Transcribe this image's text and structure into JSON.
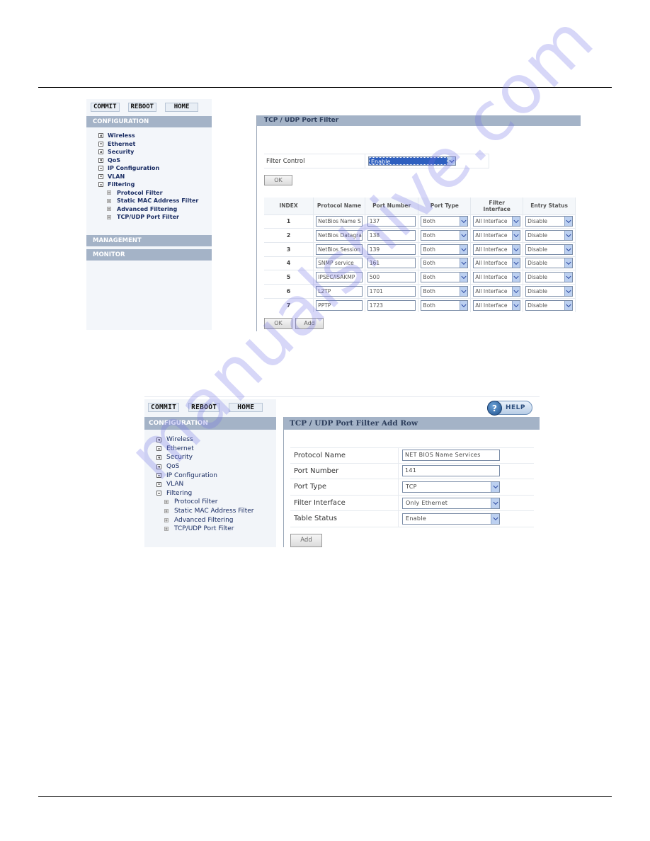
{
  "screen1": {
    "top_buttons": [
      "COMMIT",
      "REBOOT",
      "HOME"
    ],
    "sections": {
      "configuration": "CONFIGURATION",
      "management": "MANAGEMENT",
      "monitor": "MONITOR"
    },
    "tree": [
      {
        "label": "Wireless",
        "icon": "plus"
      },
      {
        "label": "Ethernet",
        "icon": "minus"
      },
      {
        "label": "Security",
        "icon": "plus"
      },
      {
        "label": "QoS",
        "icon": "plus"
      },
      {
        "label": "IP Configuration",
        "icon": "minus"
      },
      {
        "label": "VLAN",
        "icon": "minus"
      },
      {
        "label": "Filtering",
        "icon": "minus"
      }
    ],
    "subtree": [
      "Protocol Filter",
      "Static MAC Address Filter",
      "Advanced Filtering",
      "TCP/UDP Port Filter"
    ],
    "panel": {
      "title": "TCP / UDP Port Filter",
      "filter_control_label": "Filter Control",
      "filter_control_value": "Enable",
      "ok_label": "OK",
      "add_label": "Add",
      "columns": [
        "INDEX",
        "Protocol Name",
        "Port Number",
        "Port Type",
        "Filter Interface",
        "Entry Status"
      ],
      "rows": [
        {
          "index": "1",
          "protocol": "NetBios Name S",
          "port": "137",
          "type": "Both",
          "iface": "All Interface",
          "status": "Disable"
        },
        {
          "index": "2",
          "protocol": "NetBios Datagra",
          "port": "138",
          "type": "Both",
          "iface": "All Interface",
          "status": "Disable"
        },
        {
          "index": "3",
          "protocol": "NetBios Session",
          "port": "139",
          "type": "Both",
          "iface": "All Interface",
          "status": "Disable"
        },
        {
          "index": "4",
          "protocol": "SNMP service",
          "port": "161",
          "type": "Both",
          "iface": "All Interface",
          "status": "Disable"
        },
        {
          "index": "5",
          "protocol": "IPSEC/ISAKMP",
          "port": "500",
          "type": "Both",
          "iface": "All Interface",
          "status": "Disable"
        },
        {
          "index": "6",
          "protocol": "L2TP",
          "port": "1701",
          "type": "Both",
          "iface": "All Interface",
          "status": "Disable"
        },
        {
          "index": "7",
          "protocol": "PPTP",
          "port": "1723",
          "type": "Both",
          "iface": "All Interface",
          "status": "Disable"
        }
      ]
    }
  },
  "screen2": {
    "top_buttons": [
      "COMMIT",
      "REBOOT",
      "HOME"
    ],
    "help_label": "HELP",
    "help_icon": "?",
    "sections": {
      "configuration": "CONFIGURATION"
    },
    "tree": [
      {
        "label": "Wireless",
        "icon": "plus"
      },
      {
        "label": "Ethernet",
        "icon": "minus"
      },
      {
        "label": "Security",
        "icon": "plus"
      },
      {
        "label": "QoS",
        "icon": "plus"
      },
      {
        "label": "IP Configuration",
        "icon": "minus"
      },
      {
        "label": "VLAN",
        "icon": "minus"
      },
      {
        "label": "Filtering",
        "icon": "minus"
      }
    ],
    "subtree": [
      "Protocol Filter",
      "Static MAC Address Filter",
      "Advanced Filtering",
      "TCP/UDP Port Filter"
    ],
    "panel": {
      "title": "TCP / UDP Port Filter Add Row",
      "fields": [
        {
          "label": "Protocol Name",
          "kind": "input",
          "value": "NET BIOS Name Services"
        },
        {
          "label": "Port Number",
          "kind": "input",
          "value": "141"
        },
        {
          "label": "Port Type",
          "kind": "select",
          "value": "TCP"
        },
        {
          "label": "Filter Interface",
          "kind": "select",
          "value": "Only Ethernet"
        },
        {
          "label": "Table Status",
          "kind": "select",
          "value": "Enable"
        }
      ],
      "add_label": "Add"
    }
  },
  "watermark": "manualshive.com",
  "colors": {
    "section_header": "#a4b3c7",
    "sidebar_bg": "#f3f6fa",
    "selected_option": "#2e5fbf",
    "dropdown_button": "#bcd0f0",
    "tree_text": "#1a2d63"
  }
}
